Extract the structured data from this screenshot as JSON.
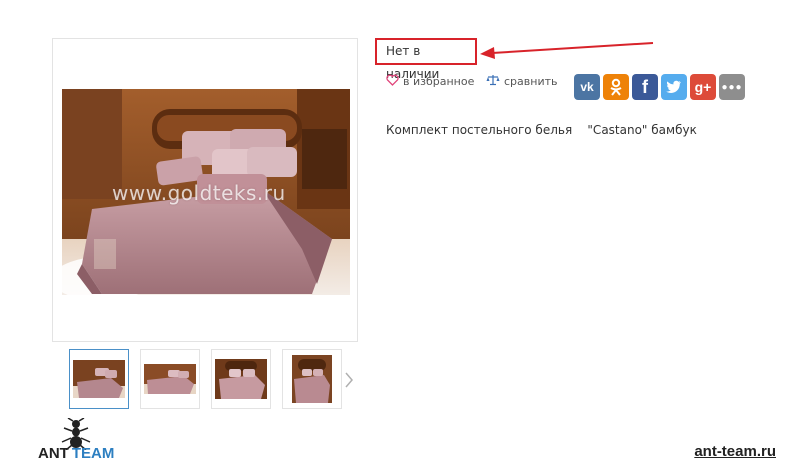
{
  "product": {
    "stock_status": "Нет в наличии",
    "title": "Комплект постельного белья    \"Castano\" бамбук",
    "image_watermark": "www.goldteks.ru"
  },
  "actions": {
    "favorite_label": "в избранное",
    "compare_label": "сравнить"
  },
  "share": {
    "buttons": [
      {
        "name": "vk",
        "color": "#4c75a3",
        "glyph": "vk"
      },
      {
        "name": "odnoklassniki",
        "color": "#ee8208",
        "glyph": "ok"
      },
      {
        "name": "facebook",
        "color": "#3b5998",
        "glyph": "f"
      },
      {
        "name": "twitter",
        "color": "#55acee",
        "glyph": "t"
      },
      {
        "name": "google-plus",
        "color": "#dd4b39",
        "glyph": "g+"
      },
      {
        "name": "more",
        "color": "#8e8e8e",
        "glyph": "•••"
      }
    ]
  },
  "thumbnails": {
    "count": 4,
    "selected_index": 0,
    "next_icon": "chevron-right-icon"
  },
  "branding": {
    "logo_word1": "ANT",
    "logo_word2": "TEAM",
    "site_url": "ant-team.ru"
  },
  "colors": {
    "highlight_red": "#d8232a",
    "thumb_active": "#4a90c8",
    "brand_blue": "#2d7fc1"
  }
}
